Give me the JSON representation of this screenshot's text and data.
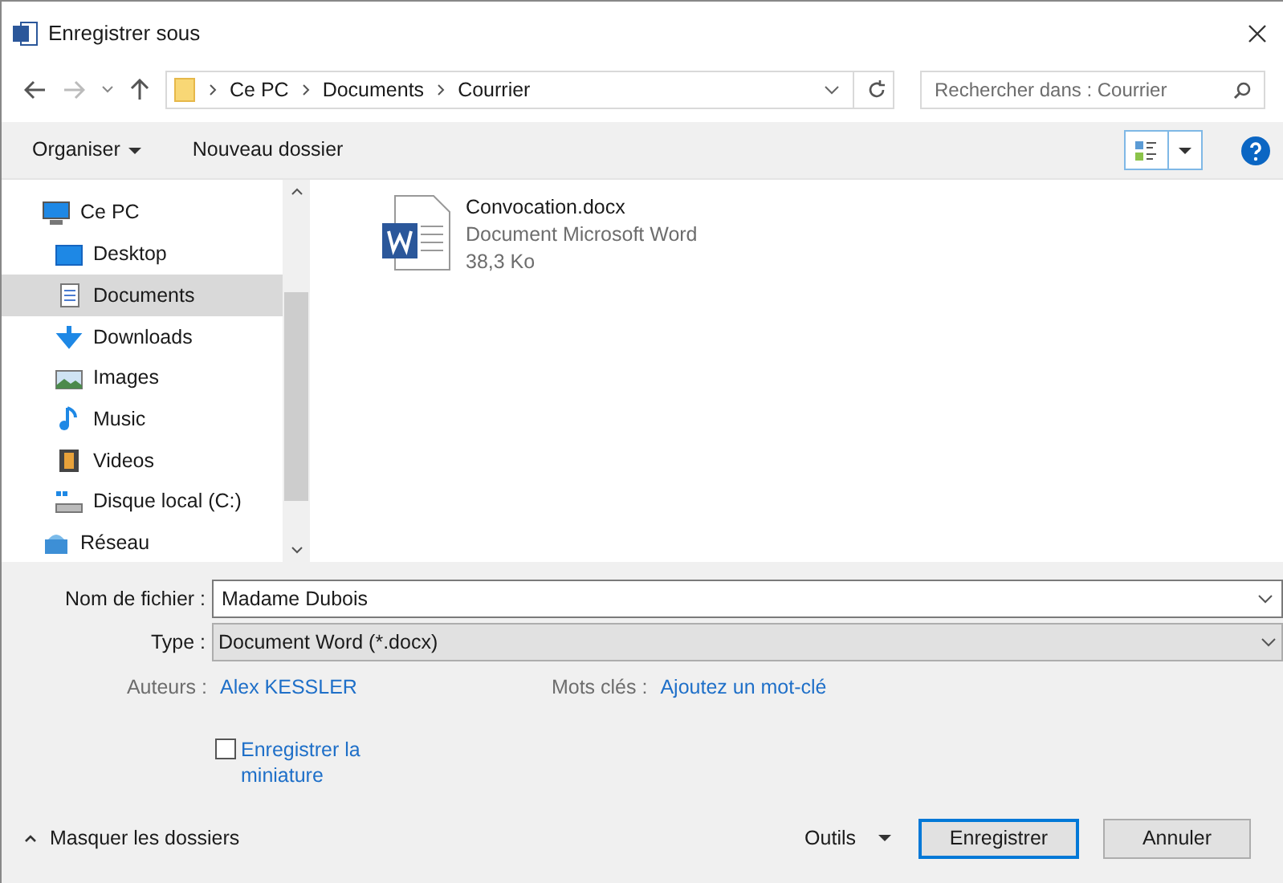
{
  "window": {
    "title": "Enregistrer sous"
  },
  "address": {
    "path": [
      "Ce PC",
      "Documents",
      "Courrier"
    ]
  },
  "search": {
    "placeholder": "Rechercher dans : Courrier"
  },
  "toolbar": {
    "organize": "Organiser",
    "new_folder": "Nouveau dossier"
  },
  "sidebar": {
    "items": [
      {
        "label": "Ce PC",
        "kind": "pc",
        "selected": false,
        "children": [
          {
            "label": "Desktop",
            "kind": "desktop",
            "selected": false
          },
          {
            "label": "Documents",
            "kind": "documents",
            "selected": true
          },
          {
            "label": "Downloads",
            "kind": "downloads",
            "selected": false
          },
          {
            "label": "Images",
            "kind": "images",
            "selected": false
          },
          {
            "label": "Music",
            "kind": "music",
            "selected": false
          },
          {
            "label": "Videos",
            "kind": "videos",
            "selected": false
          },
          {
            "label": "Disque local (C:)",
            "kind": "drive",
            "selected": false
          }
        ]
      },
      {
        "label": "Réseau",
        "kind": "network",
        "selected": false
      }
    ]
  },
  "files": [
    {
      "name": "Convocation.docx",
      "type": "Document Microsoft Word",
      "size": "38,3 Ko"
    }
  ],
  "form": {
    "filename_label": "Nom de fichier :",
    "filename": "Madame Dubois",
    "type_label": "Type :",
    "type": "Document Word (*.docx)",
    "authors_label": "Auteurs :",
    "authors": "Alex KESSLER",
    "tags_label": "Mots clés :",
    "tags": "Ajoutez un mot-clé",
    "thumbnail": {
      "label": "Enregistrer la miniature",
      "checked": false
    }
  },
  "footer": {
    "hide_folders": "Masquer les dossiers",
    "tools": "Outils",
    "save": "Enregistrer",
    "cancel": "Annuler"
  }
}
